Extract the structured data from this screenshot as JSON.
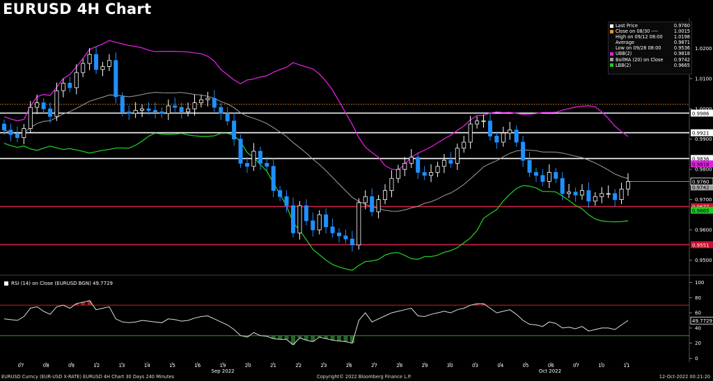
{
  "title": "EURUSD 4H Chart",
  "legend": [
    {
      "label": "Last Price",
      "value": "0.9760",
      "color": "#ffffff"
    },
    {
      "label": "Close on 08/30 ----",
      "value": "1.0015",
      "color": "#f08c28"
    },
    {
      "label": "High on 09/12 08:00",
      "value": "1.0198",
      "color": "#000000"
    },
    {
      "label": "Average",
      "value": "0.9871",
      "color": "#000000"
    },
    {
      "label": "Low on 09/28 08:00",
      "value": "0.9536",
      "color": "#000000"
    },
    {
      "label": "UBB(2)",
      "value": "0.9818",
      "color": "#e020e0"
    },
    {
      "label": "BollMA (20)  on Close",
      "value": "0.9742",
      "color": "#a0a0a0"
    },
    {
      "label": "LBB(2)",
      "value": "0.9665",
      "color": "#22c822"
    }
  ],
  "rsi_label": "RSI (14)  on Close (EURUSD BGN) 49.7729",
  "footer": {
    "left": "EURUSD Curncy (EUR-USD X-RATE) EURUSD 4H Chart 30 Days 240 Minutes",
    "center": "Copyright© 2022 Bloomberg Finance L.P.",
    "right": "12-Oct-2022 00:21:20"
  },
  "chart_data": {
    "type": "candlestick",
    "title": "EURUSD 4H Chart",
    "x_day_labels": [
      "07",
      "08",
      "09",
      "12",
      "13",
      "14",
      "15",
      "16",
      "19",
      "20",
      "21",
      "22",
      "23",
      "26",
      "27",
      "28",
      "29",
      "30",
      "03",
      "04",
      "05",
      "06",
      "07",
      "10",
      "11"
    ],
    "month_labels": [
      "Sep 2022",
      "Oct 2022"
    ],
    "price_axis": {
      "ticks": [
        "1.0200",
        "1.0100",
        "1.0000",
        "0.9900",
        "0.9800",
        "0.9700",
        "0.9600",
        "0.9500"
      ],
      "ylim": [
        0.9455,
        1.03
      ]
    },
    "horizontal_levels": [
      {
        "label": "0.9986",
        "value": 0.9986,
        "color": "#ffffff"
      },
      {
        "label": "0.9921",
        "value": 0.9921,
        "color": "#ffffff"
      },
      {
        "label": "0.9836",
        "value": 0.9836,
        "color": "#ffffff"
      },
      {
        "label": "0.9677",
        "value": 0.9677,
        "color": "#cc2244"
      },
      {
        "label": "0.9551",
        "value": 0.9551,
        "color": "#cc2244"
      }
    ],
    "last_price_label": "0.9760",
    "close_0830_level": 1.0015,
    "side_tags": [
      {
        "label": "0.9818",
        "color": "#e020e0",
        "value": 0.9818
      },
      {
        "label": "0.9742",
        "color": "#a0a0a0",
        "value": 0.9742
      },
      {
        "label": "0.9665",
        "color": "#22c822",
        "value": 0.9665
      }
    ],
    "close": [
      0.993,
      0.9915,
      0.9905,
      0.9935,
      1.0005,
      1.002,
      1.0,
      0.9975,
      1.006,
      1.0085,
      1.007,
      1.012,
      1.015,
      1.018,
      1.013,
      1.014,
      1.016,
      1.004,
      0.999,
      0.9985,
      0.9995,
      1.0,
      0.9995,
      0.999,
      0.9985,
      1.001,
      1.0005,
      0.999,
      1.0,
      1.002,
      1.003,
      1.0035,
      1.0005,
      0.9985,
      0.996,
      0.99,
      0.982,
      0.981,
      0.986,
      0.982,
      0.981,
      0.973,
      0.971,
      0.968,
      0.959,
      0.968,
      0.963,
      0.96,
      0.965,
      0.961,
      0.959,
      0.958,
      0.957,
      0.955,
      0.969,
      0.971,
      0.966,
      0.97,
      0.973,
      0.977,
      0.98,
      0.982,
      0.984,
      0.979,
      0.978,
      0.979,
      0.981,
      0.983,
      0.982,
      0.987,
      0.989,
      0.995,
      0.996,
      0.996,
      0.991,
      0.989,
      0.992,
      0.993,
      0.989,
      0.983,
      0.979,
      0.978,
      0.976,
      0.979,
      0.977,
      0.972,
      0.9725,
      0.9715,
      0.973,
      0.9695,
      0.971,
      0.972,
      0.972,
      0.97,
      0.9735,
      0.976
    ],
    "bollinger": {
      "upper": 0.9818,
      "middle": 0.9742,
      "lower": 0.9665
    },
    "rsi": {
      "label": "RSI (14) on Close",
      "last": 49.7729,
      "ticks": [
        "100",
        "80",
        "60",
        "40",
        "20",
        "0"
      ],
      "ylim": [
        -5,
        105
      ],
      "overbought": 70,
      "oversold": 30,
      "values": [
        52,
        51,
        50,
        55,
        66,
        68,
        62,
        58,
        68,
        70,
        66,
        72,
        74,
        76,
        64,
        66,
        68,
        52,
        48,
        47,
        48,
        50,
        49,
        48,
        47,
        52,
        51,
        49,
        50,
        53,
        55,
        56,
        52,
        48,
        44,
        38,
        30,
        28,
        34,
        30,
        29,
        26,
        25,
        25,
        18,
        27,
        24,
        22,
        28,
        26,
        24,
        23,
        22,
        20,
        50,
        60,
        48,
        52,
        56,
        60,
        62,
        64,
        66,
        56,
        55,
        58,
        60,
        62,
        60,
        64,
        66,
        70,
        72,
        72,
        66,
        60,
        62,
        64,
        58,
        50,
        45,
        44,
        42,
        48,
        46,
        40,
        41,
        39,
        42,
        36,
        38,
        40,
        40,
        38,
        44,
        50
      ]
    }
  }
}
